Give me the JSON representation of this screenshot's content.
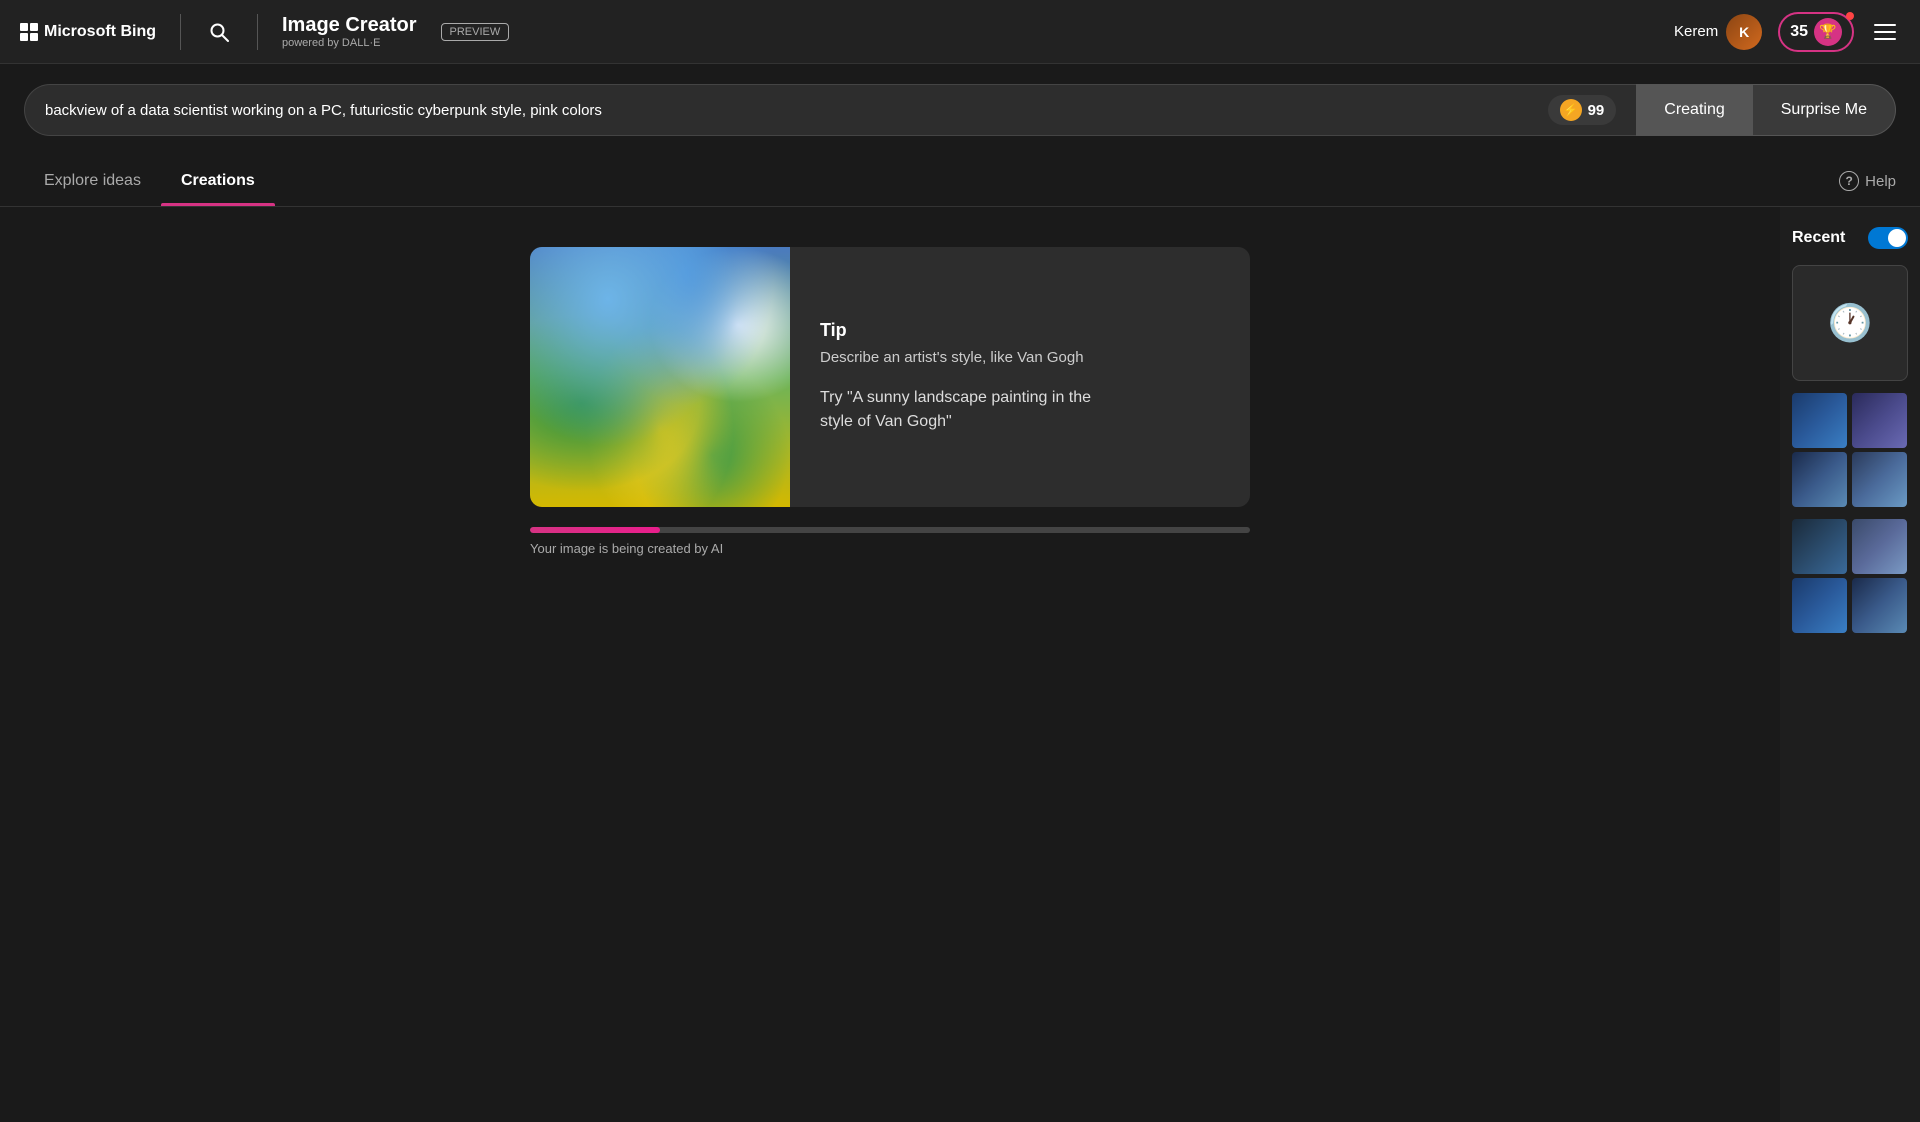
{
  "header": {
    "bing_text": "Microsoft Bing",
    "app_title": "Image Creator",
    "app_subtitle": "powered by DALL·E",
    "preview_label": "PREVIEW",
    "user_name": "Kerem",
    "reward_count": "35",
    "search_icon_label": "🔍"
  },
  "search_bar": {
    "input_value": "backview of a data scientist working on a PC, futuricstic cyberpunk style, pink colors",
    "coin_count": "99",
    "creating_label": "Creating",
    "surprise_label": "Surprise Me"
  },
  "tabs": {
    "explore_label": "Explore ideas",
    "creations_label": "Creations",
    "help_label": "Help"
  },
  "tip_card": {
    "label": "Tip",
    "description": "Describe an artist's style, like Van Gogh",
    "example": "Try \"A sunny landscape painting in the\nstyle of Van Gogh\""
  },
  "progress": {
    "status_text": "Your image is being created by AI",
    "fill_percent": 18
  },
  "sidebar": {
    "recent_label": "Recent",
    "toggle_on": true
  }
}
